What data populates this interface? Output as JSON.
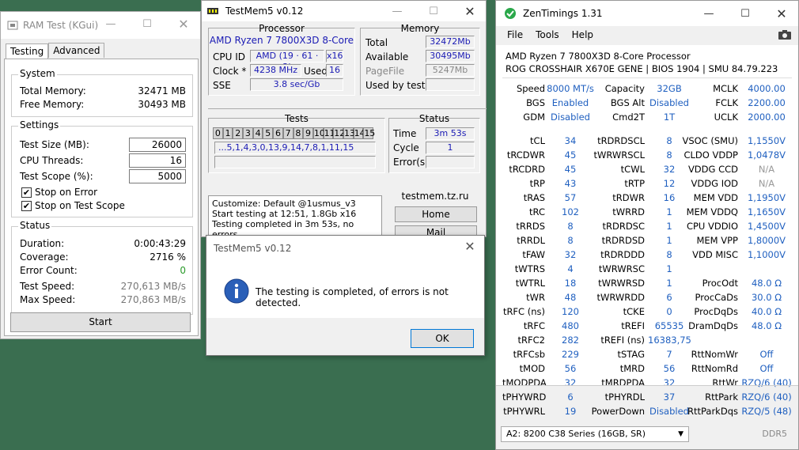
{
  "ramtest": {
    "title": "RAM Test (KGui)",
    "tabs": [
      "Testing",
      "Advanced"
    ],
    "system": {
      "label": "System",
      "total_label": "Total Memory:",
      "total": "32471 MB",
      "free_label": "Free Memory:",
      "free": "30493 MB"
    },
    "settings": {
      "label": "Settings",
      "size_label": "Test Size (MB):",
      "size": "26000",
      "threads_label": "CPU Threads:",
      "threads": "16",
      "scope_label": "Test Scope (%):",
      "scope": "5000",
      "stop_error": "Stop on Error",
      "stop_scope": "Stop on Test Scope"
    },
    "status": {
      "label": "Status",
      "duration_label": "Duration:",
      "duration": "0:00:43:29",
      "coverage_label": "Coverage:",
      "coverage": "2716 %",
      "errors_label": "Error Count:",
      "errors": "0",
      "speed_label": "Test Speed:",
      "speed": "270,613 MB/s",
      "max_label": "Max Speed:",
      "max": "270,863 MB/s"
    },
    "start": "Start"
  },
  "testmem": {
    "title": "TestMem5 v0.12",
    "processor": {
      "label": "Processor",
      "name": "AMD Ryzen 7 7800X3D 8-Core",
      "cpuid_label": "CPU ID",
      "cpuid": "AMD  (19 · 61 · 2)",
      "cpuid_x": "x16",
      "clock_label": "Clock *",
      "clock": "4238 MHz",
      "used_label": "Used",
      "used": "16",
      "sse_label": "SSE",
      "sse": "3.8 sec/Gb"
    },
    "memory": {
      "label": "Memory",
      "total_label": "Total",
      "total": "32472Mb",
      "avail_label": "Available",
      "avail": "30495Mb",
      "pagefile_label": "PageFile",
      "pagefile": "5247Mb",
      "usedby_label": "Used by test",
      "usedby": ""
    },
    "tests": {
      "label": "Tests",
      "cells": [
        "0",
        "1",
        "2",
        "3",
        "4",
        "5",
        "6",
        "7",
        "8",
        "9",
        "10",
        "11",
        "12",
        "13",
        "14",
        "15"
      ],
      "sequence": "...5,1,4,3,0,13,9,14,7,8,1,11,15"
    },
    "status": {
      "label": "Status",
      "time_label": "Time",
      "time": "3m 53s",
      "cycle_label": "Cycle",
      "cycle": "1",
      "errors_label": "Error(s)",
      "errors": ""
    },
    "log": [
      "Customize: Default @1usmus_v3",
      "Start testing at 12:51, 1.8Gb x16",
      "Testing completed in 3m 53s, no errors."
    ],
    "site": "testmem.tz.ru",
    "home": "Home",
    "mail": "Mail"
  },
  "dialog": {
    "title": "TestMem5 v0.12",
    "message": "The testing is completed, of errors is not detected.",
    "ok": "OK"
  },
  "zen": {
    "title": "ZenTimings 1.31",
    "menu": [
      "File",
      "Tools",
      "Help"
    ],
    "cpu": "AMD Ryzen 7 7800X3D 8-Core Processor",
    "board": "ROG CROSSHAIR X670E GENE | BIOS 1904 | SMU 84.79.223",
    "top": [
      [
        [
          "Speed",
          "8000 MT/s"
        ],
        [
          "Capacity",
          "32GB"
        ],
        [
          "MCLK",
          "4000.00"
        ]
      ],
      [
        [
          "BGS",
          "Enabled"
        ],
        [
          "BGS Alt",
          "Disabled"
        ],
        [
          "FCLK",
          "2200.00"
        ]
      ],
      [
        [
          "GDM",
          "Disabled"
        ],
        [
          "Cmd2T",
          "1T"
        ],
        [
          "UCLK",
          "2000.00"
        ]
      ]
    ],
    "rows": [
      [
        [
          "tCL",
          "34"
        ],
        [
          "tRDRDSCL",
          "8"
        ],
        [
          "VSOC (SMU)",
          "1,1550V"
        ]
      ],
      [
        [
          "tRCDWR",
          "45"
        ],
        [
          "tWRWRSCL",
          "8"
        ],
        [
          "CLDO VDDP",
          "1,0478V"
        ]
      ],
      [
        [
          "tRCDRD",
          "45"
        ],
        [
          "tCWL",
          "32"
        ],
        [
          "VDDG CCD",
          "N/A"
        ]
      ],
      [
        [
          "tRP",
          "43"
        ],
        [
          "tRTP",
          "12"
        ],
        [
          "VDDG IOD",
          "N/A"
        ]
      ],
      [
        [
          "tRAS",
          "57"
        ],
        [
          "tRDWR",
          "16"
        ],
        [
          "MEM VDD",
          "1,1950V"
        ]
      ],
      [
        [
          "tRC",
          "102"
        ],
        [
          "tWRRD",
          "1"
        ],
        [
          "MEM VDDQ",
          "1,1650V"
        ]
      ],
      [
        [
          "tRRDS",
          "8"
        ],
        [
          "tRDRDSC",
          "1"
        ],
        [
          "CPU VDDIO",
          "1,4500V"
        ]
      ],
      [
        [
          "tRRDL",
          "8"
        ],
        [
          "tRDRDSD",
          "1"
        ],
        [
          "MEM VPP",
          "1,8000V"
        ]
      ],
      [
        [
          "tFAW",
          "32"
        ],
        [
          "tRDRDDD",
          "8"
        ],
        [
          "VDD MISC",
          "1,1000V"
        ]
      ],
      [
        [
          "tWTRS",
          "4"
        ],
        [
          "tWRWRSC",
          "1"
        ],
        [
          "",
          ""
        ]
      ],
      [
        [
          "tWTRL",
          "18"
        ],
        [
          "tWRWRSD",
          "1"
        ],
        [
          "ProcOdt",
          "48.0 Ω"
        ]
      ],
      [
        [
          "tWR",
          "48"
        ],
        [
          "tWRWRDD",
          "6"
        ],
        [
          "ProcCaDs",
          "30.0 Ω"
        ]
      ],
      [
        [
          "tRFC (ns)",
          "120"
        ],
        [
          "tCKE",
          "0"
        ],
        [
          "ProcDqDs",
          "40.0 Ω"
        ]
      ],
      [
        [
          "tRFC",
          "480"
        ],
        [
          "tREFI",
          "65535"
        ],
        [
          "DramDqDs",
          "48.0 Ω"
        ]
      ],
      [
        [
          "tRFC2",
          "282"
        ],
        [
          "tREFI (ns)",
          "16383,75"
        ],
        [
          "",
          ""
        ]
      ],
      [
        [
          "tRFCsb",
          "229"
        ],
        [
          "tSTAG",
          "7"
        ],
        [
          "RttNomWr",
          "Off"
        ]
      ],
      [
        [
          "tMOD",
          "56"
        ],
        [
          "tMRD",
          "56"
        ],
        [
          "RttNomRd",
          "Off"
        ]
      ],
      [
        [
          "tMODPDA",
          "32"
        ],
        [
          "tMRDPDA",
          "32"
        ],
        [
          "RttWr",
          "RZQ/6 (40)"
        ]
      ],
      [
        [
          "tPHYWRD",
          "6"
        ],
        [
          "tPHYRDL",
          "37"
        ],
        [
          "RttPark",
          "RZQ/6 (40)"
        ]
      ],
      [
        [
          "tPHYWRL",
          "19"
        ],
        [
          "PowerDown",
          "Disabled"
        ],
        [
          "RttParkDqs",
          "RZQ/5 (48)"
        ]
      ]
    ],
    "profile": "A2: 8200 C38 Series (16GB, SR)",
    "ddr": "DDR5"
  }
}
